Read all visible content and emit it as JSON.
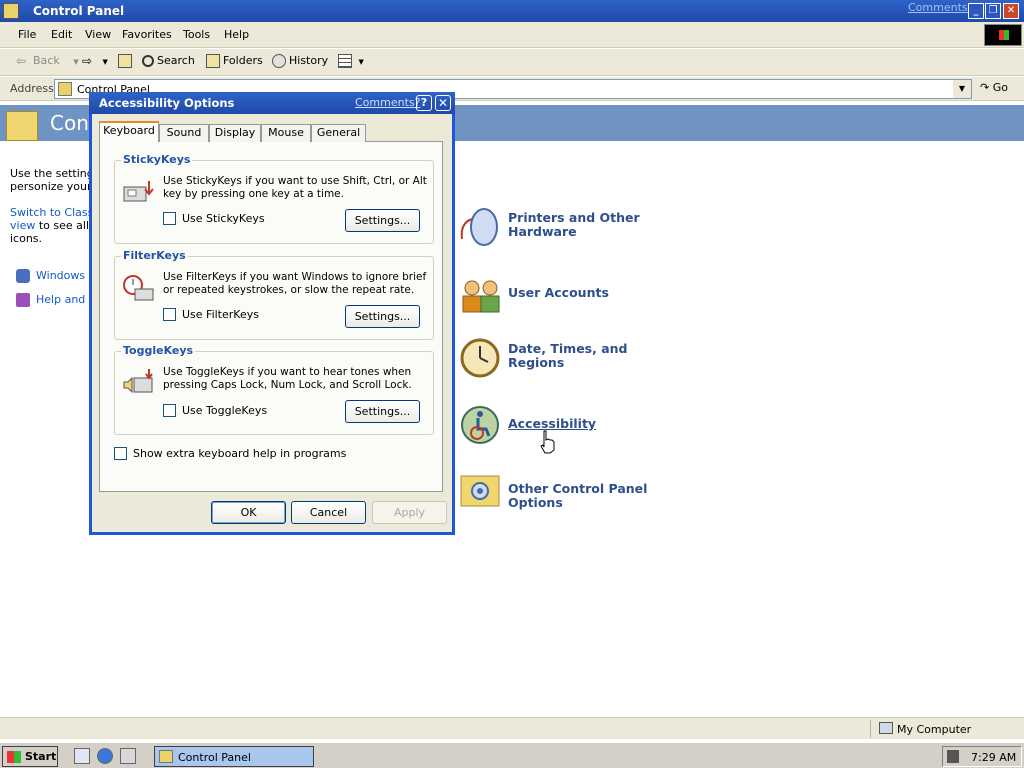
{
  "window": {
    "title": "Control Panel",
    "comments_link": "Comments?",
    "buttons": {
      "minimize": "_",
      "restore": "❐",
      "close": "✕"
    }
  },
  "menu": [
    "File",
    "Edit",
    "View",
    "Favorites",
    "Tools",
    "Help"
  ],
  "toolbar": {
    "back": "Back",
    "search": "Search",
    "folders": "Folders",
    "history": "History"
  },
  "address": {
    "label": "Address",
    "value": "Control Panel",
    "go": "Go"
  },
  "banner": {
    "title": "Contr"
  },
  "left_pane": {
    "line1": "Use the settings",
    "line2": "personize your",
    "link_line1": "Switch to Classic",
    "link_line2": "view",
    "link_tail": " to see all it",
    "line_after": "icons.",
    "link_windows": "Windows U",
    "link_help": "Help and S"
  },
  "categories": [
    {
      "label": "Printers and Other Hardware",
      "icon": "mouse-icon"
    },
    {
      "label": "User Accounts",
      "icon": "users-icon"
    },
    {
      "label": "Date, Times, and Regions",
      "icon": "clock-icon"
    },
    {
      "label": "Accessibility",
      "icon": "accessibility-icon"
    },
    {
      "label": "Other Control Panel Options",
      "icon": "folder-gear-icon"
    }
  ],
  "dialog": {
    "title": "Accessibility Options",
    "comments_link": "Comments?",
    "help": "?",
    "close": "✕",
    "tabs": [
      "Keyboard",
      "Sound",
      "Display",
      "Mouse",
      "General"
    ],
    "active_tab": "Keyboard",
    "groups": [
      {
        "title": "StickyKeys",
        "desc": "Use StickyKeys if you want to use Shift, Ctrl, or Alt key by pressing one key at a time.",
        "checkbox": "Use StickyKeys",
        "checked": false,
        "settings": "Settings..."
      },
      {
        "title": "FilterKeys",
        "desc": "Use FilterKeys if you want Windows to ignore brief or repeated keystrokes, or slow the repeat rate.",
        "checkbox": "Use FilterKeys",
        "checked": false,
        "settings": "Settings..."
      },
      {
        "title": "ToggleKeys",
        "desc": "Use ToggleKeys if you want to hear tones when pressing Caps Lock, Num Lock, and Scroll Lock.",
        "checkbox": "Use ToggleKeys",
        "checked": false,
        "settings": "Settings..."
      }
    ],
    "extra_help": "Show extra keyboard help in programs",
    "ok": "OK",
    "cancel": "Cancel",
    "apply": "Apply"
  },
  "status": {
    "zone": "My Computer"
  },
  "taskbar": {
    "start": "Start",
    "task": "Control Panel",
    "clock": "7:29 AM"
  },
  "colors": {
    "titlebar": "#1f4aa8",
    "banner": "#6f93c2",
    "category_text": "#2e4f8c",
    "group_title": "#2153a7"
  }
}
